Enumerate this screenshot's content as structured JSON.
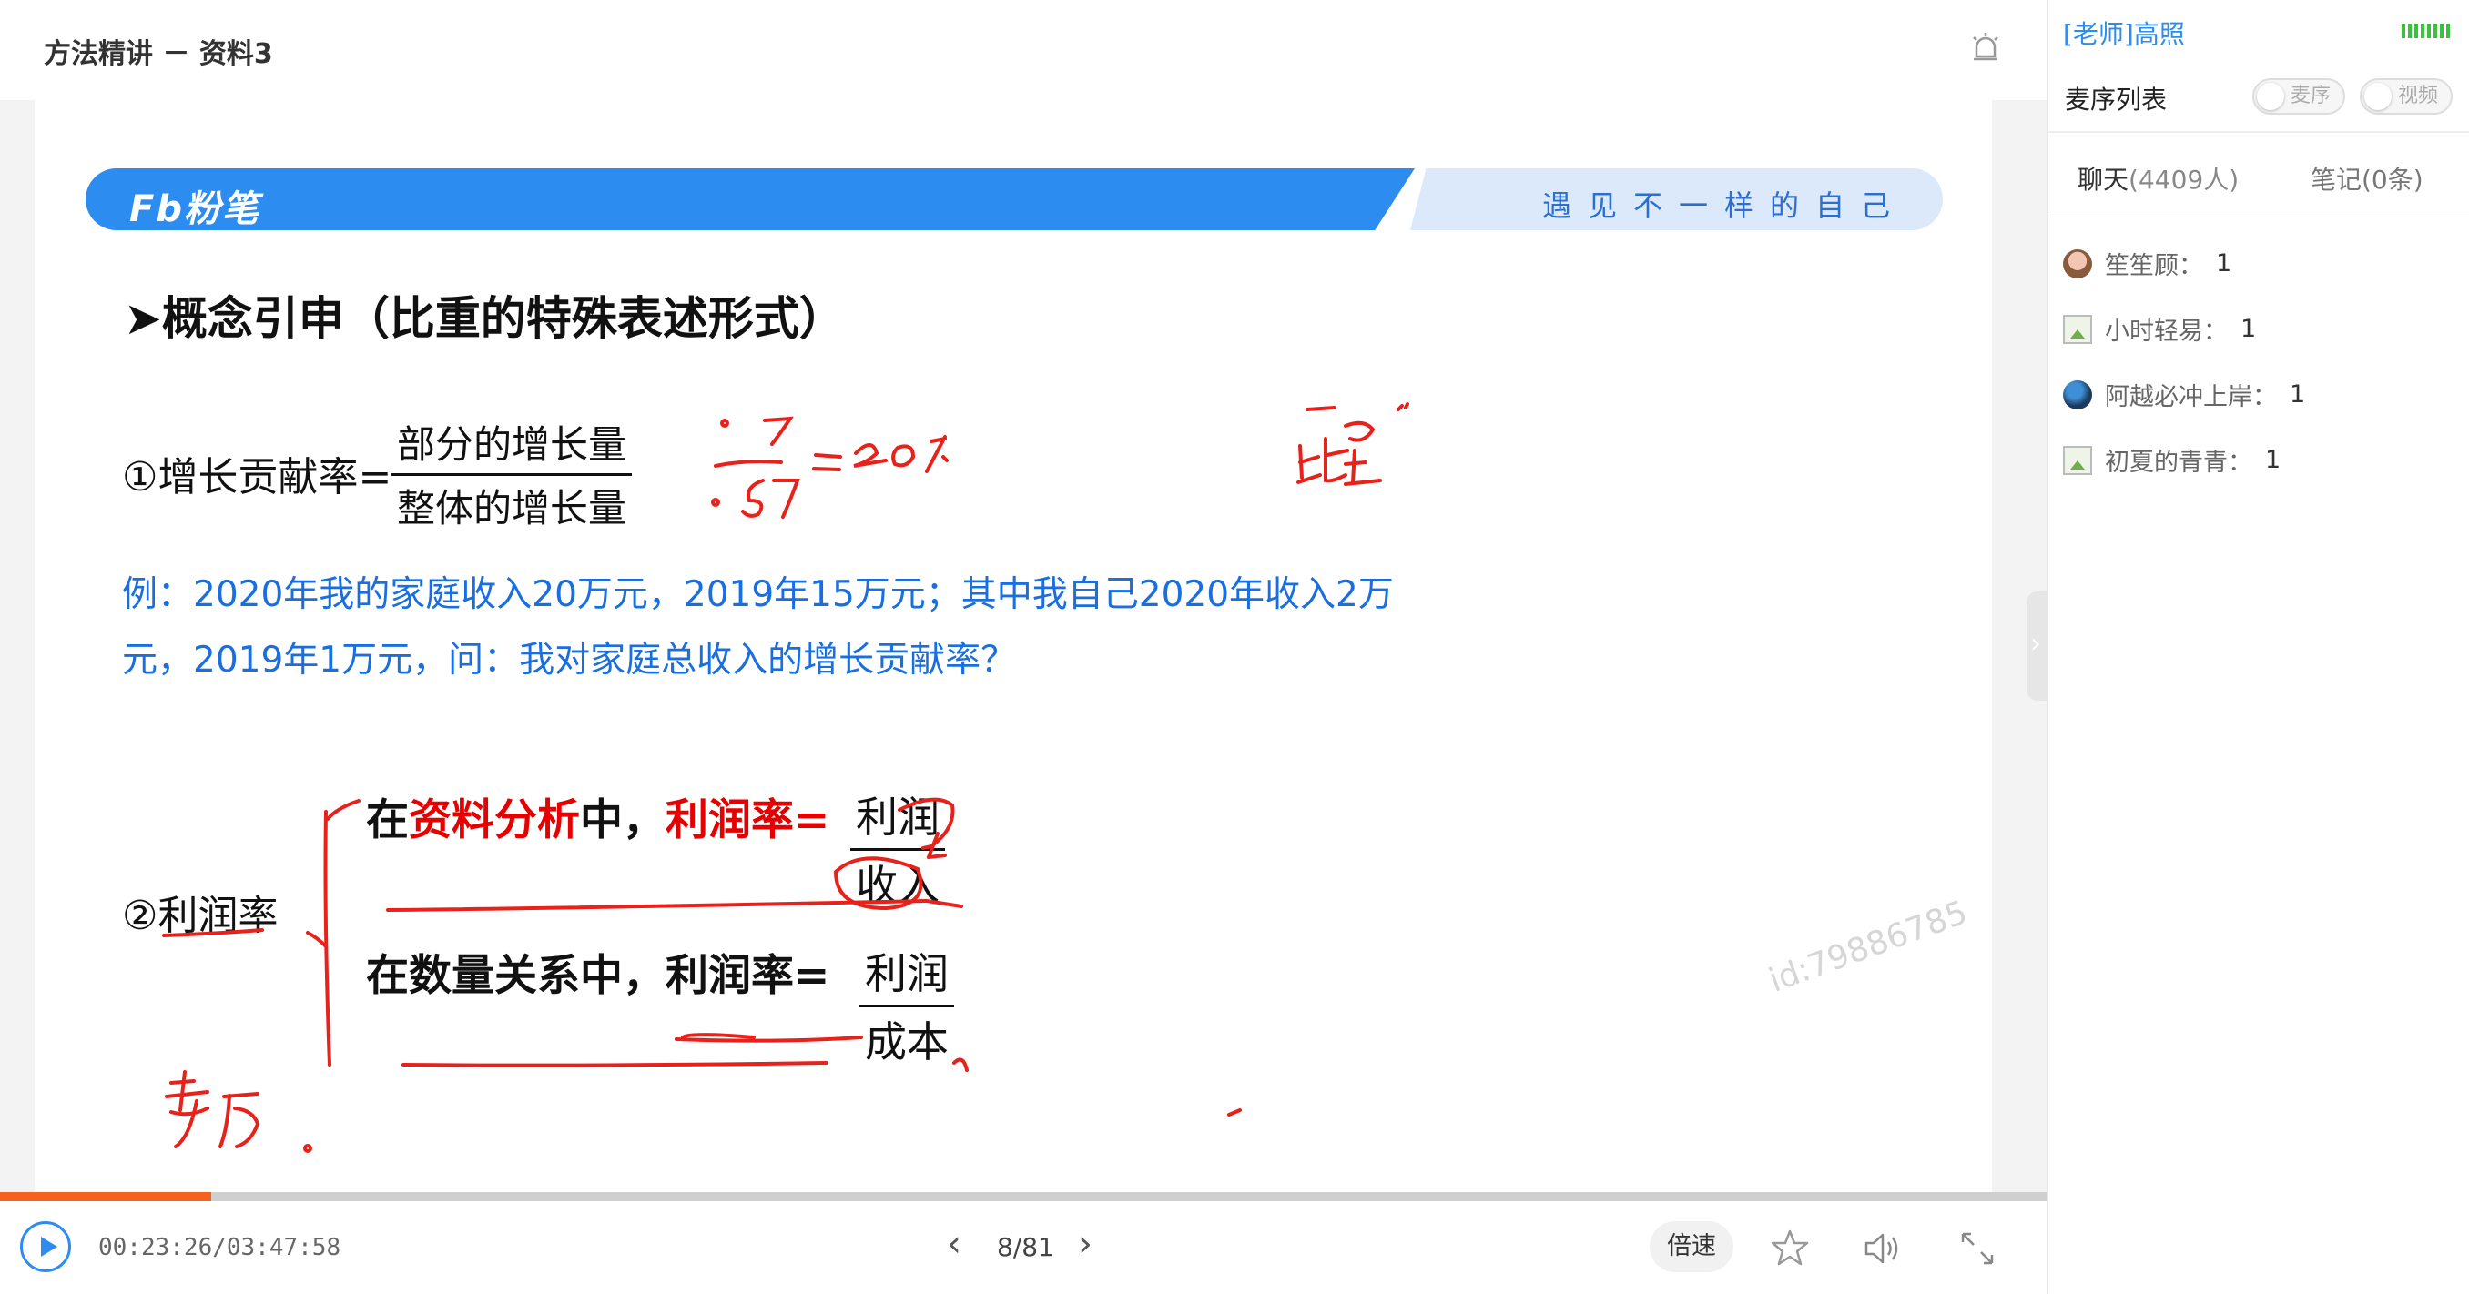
{
  "header": {
    "title": "方法精讲 － 资料3"
  },
  "slide": {
    "brand": "Fb粉笔",
    "slogan": "遇见不一样的自己",
    "concept_title": "➤概念引申（比重的特殊表述形式）",
    "formula1": {
      "label": "①增长贡献率=",
      "numerator": "部分的增长量",
      "denominator": "整体的增长量"
    },
    "example_line1": "例：2020年我的家庭收入20万元，2019年15万元；其中我自己2020年收入2万",
    "example_line2": "元，2019年1万元，问：我对家庭总收入的增长贡献率？",
    "profit_label": "②利润率",
    "profit_line1": {
      "pre": "在",
      "red1": "资料分析",
      "mid": "中，",
      "red2": "利润率",
      "eq": "=",
      "num": "利润",
      "den": "收入"
    },
    "profit_line2": {
      "pre": "在数量关系中，",
      "bold2": "利润率",
      "eq": "=",
      "num": "利润",
      "den": "成本"
    },
    "watermark": "id:79886785"
  },
  "player": {
    "time": "00:23:26/03:47:58",
    "progress": 0.103,
    "page": "8/81",
    "speed_label": "倍速",
    "accent": "#2d8cf0",
    "progress_color": "#f5621c"
  },
  "panel": {
    "teacher": "[老师]高照",
    "mic_title": "麦序列表",
    "toggle_mic": "麦序",
    "toggle_video": "视频",
    "tab_chat": "聊天",
    "tab_chat_count": "(4409人)",
    "tab_notes": "笔记(0条)",
    "users": [
      {
        "name": "笙笙顾：",
        "count": "1",
        "avatar": "face"
      },
      {
        "name": "小时轻易：",
        "count": "1",
        "avatar": "img"
      },
      {
        "name": "阿越必冲上岸：",
        "count": "1",
        "avatar": "dark"
      },
      {
        "name": "初夏的青青：",
        "count": "1",
        "avatar": "img"
      }
    ]
  }
}
